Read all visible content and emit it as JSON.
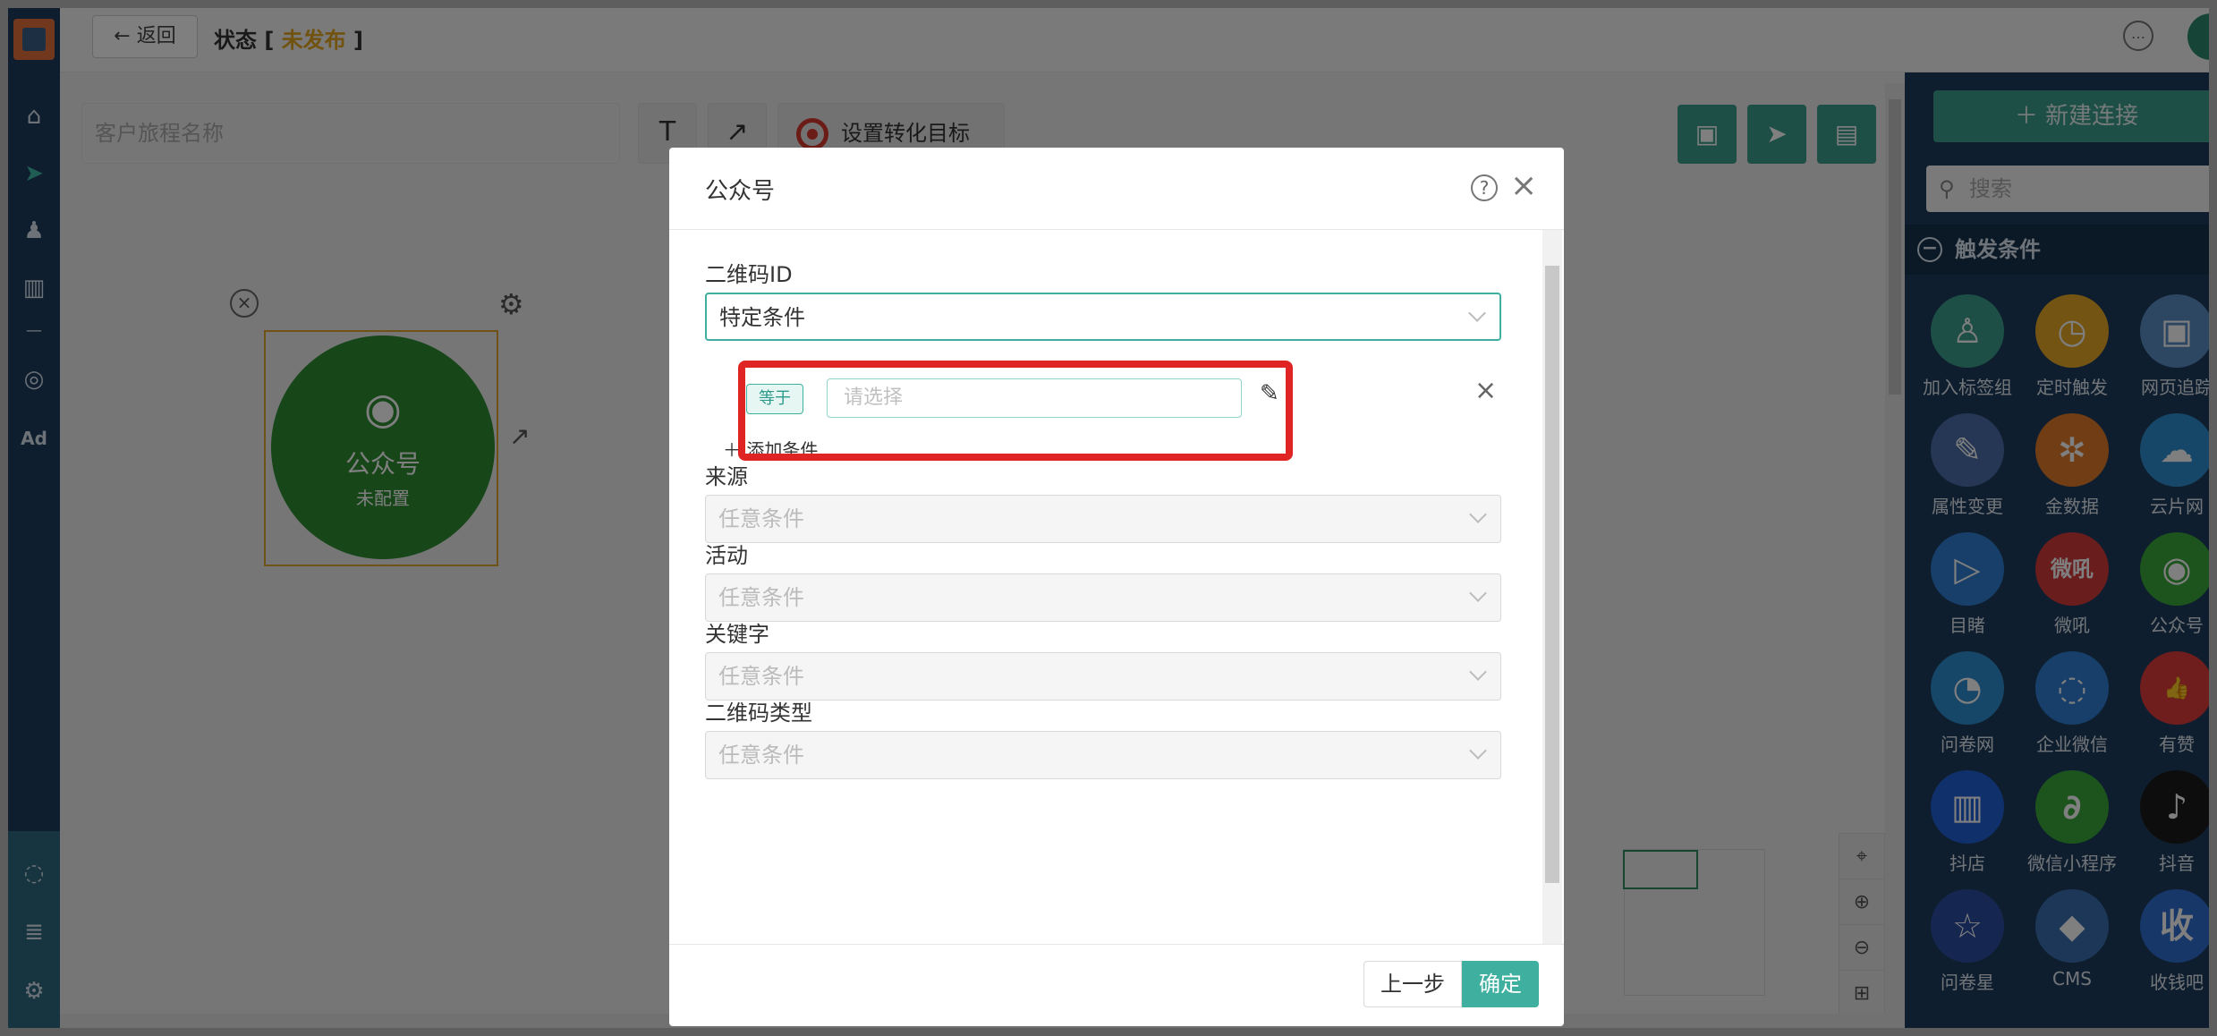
{
  "topbar": {
    "back_label": "← 返回",
    "status_prefix": "状态 [ ",
    "status_value": "未发布",
    "status_suffix": " ]"
  },
  "canvas": {
    "journey_name_placeholder": "客户旅程名称",
    "text_tool": "T",
    "arrow_tool": "↗",
    "goal_label": "设置转化目标",
    "node": {
      "title": "公众号",
      "subtitle": "未配置"
    }
  },
  "rightpanel": {
    "new_connection": "＋ 新建连接",
    "search_placeholder": "搜索",
    "section_title": "触发条件",
    "tiles": [
      {
        "label": "加入标签组",
        "color": "#3b9e8c",
        "icon": "user-plus-icon",
        "glyph": "♙"
      },
      {
        "label": "定时触发",
        "color": "#e9a825",
        "icon": "clock-icon",
        "glyph": "◷"
      },
      {
        "label": "网页追踪",
        "color": "#5b8fc7",
        "icon": "webpage-icon",
        "glyph": "▣"
      },
      {
        "label": "属性变更",
        "color": "#4a6fa8",
        "icon": "edit-icon",
        "glyph": "✎"
      },
      {
        "label": "金数据",
        "color": "#e07b2a",
        "icon": "jinshuju-icon",
        "glyph": "✲"
      },
      {
        "label": "云片网",
        "color": "#2f8fd0",
        "icon": "cloud-icon",
        "glyph": "☁"
      },
      {
        "label": "目睹",
        "color": "#2f7fd4",
        "icon": "play-icon",
        "glyph": "▷"
      },
      {
        "label": "微吼",
        "color": "#d23b3b",
        "icon": "weihou-icon",
        "glyph": "微吼"
      },
      {
        "label": "公众号",
        "color": "#3aa83a",
        "icon": "wechat-icon",
        "glyph": "◉"
      },
      {
        "label": "问卷网",
        "color": "#2f8fd0",
        "icon": "wenjuan-icon",
        "glyph": "◔"
      },
      {
        "label": "企业微信",
        "color": "#2f7fd4",
        "icon": "wecom-icon",
        "glyph": "◌"
      },
      {
        "label": "有赞",
        "color": "#e03a3a",
        "icon": "thumbs-up-icon",
        "glyph": "👍"
      },
      {
        "label": "抖店",
        "color": "#2060d8",
        "icon": "doudian-icon",
        "glyph": "▥"
      },
      {
        "label": "微信小程序",
        "color": "#3aa83a",
        "icon": "miniprogram-icon",
        "glyph": "∂"
      },
      {
        "label": "抖音",
        "color": "#1a1a1a",
        "icon": "tiktok-icon",
        "glyph": "♪"
      },
      {
        "label": "问卷星",
        "color": "#2a4fa0",
        "icon": "star-icon",
        "glyph": "☆"
      },
      {
        "label": "CMS",
        "color": "#3a6fb0",
        "icon": "cms-icon",
        "glyph": "◆"
      },
      {
        "label": "收钱吧",
        "color": "#2f6fd0",
        "icon": "shouqianba-icon",
        "glyph": "收"
      }
    ]
  },
  "modal": {
    "title": "公众号",
    "fields": [
      {
        "label": "二维码ID",
        "value": "特定条件"
      },
      {
        "label": "来源",
        "value": "任意条件"
      },
      {
        "label": "活动",
        "value": "任意条件"
      },
      {
        "label": "关键字",
        "value": "任意条件"
      },
      {
        "label": "二维码类型",
        "value": "任意条件"
      }
    ],
    "condition": {
      "operator": "等于",
      "placeholder": "请选择",
      "add_label": "＋ 添加条件"
    },
    "footer": {
      "prev_label": "上一步",
      "ok_label": "确定"
    }
  }
}
